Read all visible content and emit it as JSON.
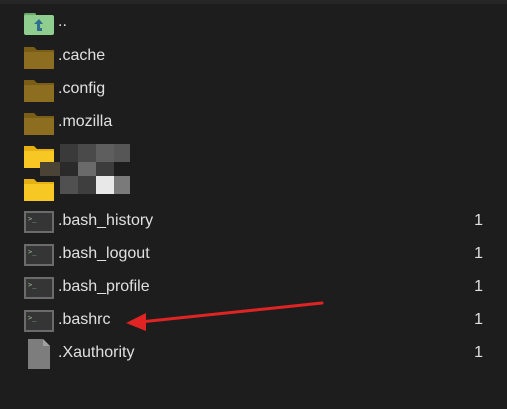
{
  "file_list": {
    "rows": [
      {
        "name": "..",
        "icon": "parent-folder-icon",
        "count": ""
      },
      {
        "name": ".cache",
        "icon": "folder-icon",
        "count": ""
      },
      {
        "name": ".config",
        "icon": "folder-icon",
        "count": ""
      },
      {
        "name": ".mozilla",
        "icon": "folder-icon",
        "count": ""
      },
      {
        "name": "",
        "icon": "folder-icon",
        "count": ""
      },
      {
        "name": "",
        "icon": "folder-icon",
        "count": ""
      },
      {
        "name": ".bash_history",
        "icon": "terminal-file-icon",
        "count": "1"
      },
      {
        "name": ".bash_logout",
        "icon": "terminal-file-icon",
        "count": "1"
      },
      {
        "name": ".bash_profile",
        "icon": "terminal-file-icon",
        "count": "1"
      },
      {
        "name": ".bashrc",
        "icon": "terminal-file-icon",
        "count": "1"
      },
      {
        "name": ".Xauthority",
        "icon": "document-icon",
        "count": "1"
      }
    ]
  },
  "annotation": {
    "arrow_color": "#e02424",
    "points_to": ".bashrc"
  },
  "colors": {
    "background": "#1d1d1d",
    "text": "#e0e0e0",
    "folder_dark": "#8a6a1e",
    "folder_bright": "#f5c518",
    "parent_folder": "#7fbf7f"
  }
}
